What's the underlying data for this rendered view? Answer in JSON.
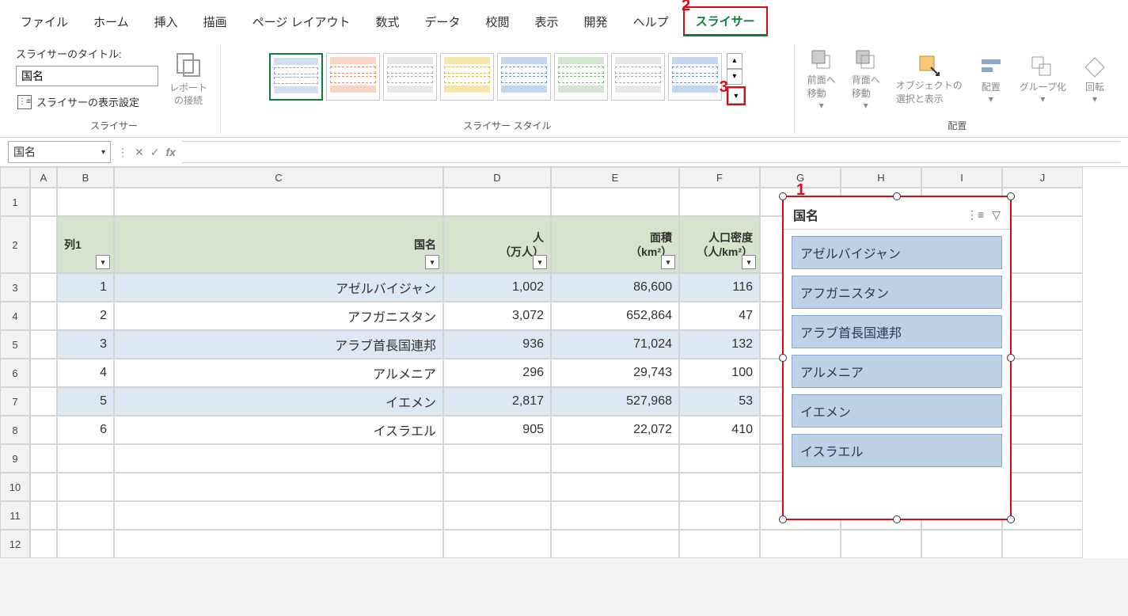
{
  "tabs": [
    "ファイル",
    "ホーム",
    "挿入",
    "描画",
    "ページ レイアウト",
    "数式",
    "データ",
    "校閲",
    "表示",
    "開発",
    "ヘルプ",
    "スライサー"
  ],
  "active_tab_index": 11,
  "ribbon": {
    "slicer_group": {
      "title_label": "スライサーのタイトル:",
      "title_value": "国名",
      "settings_label": "スライサーの表示設定",
      "report_conn_label": "レポート\nの接続",
      "group_name": "スライサー"
    },
    "styles_group_name": "スライサー スタイル",
    "arrange": {
      "bring_forward": "前面へ\n移動",
      "send_backward": "背面へ\n移動",
      "selection_pane": "オブジェクトの\n選択と表示",
      "align": "配置",
      "group": "グループ化",
      "rotate": "回転",
      "group_name": "配置"
    }
  },
  "name_box": "国名",
  "columns": [
    "A",
    "B",
    "C",
    "D",
    "E",
    "F",
    "G",
    "H",
    "I",
    "J"
  ],
  "row_headers": [
    "1",
    "2",
    "3",
    "4",
    "5",
    "6",
    "7",
    "8",
    "9",
    "10",
    "11",
    "12"
  ],
  "table": {
    "headers": {
      "b": "列1",
      "c": "国名",
      "d": "人\n（万人）",
      "e": "面積\n（km²）",
      "f": "人口密度\n（人/km²）"
    },
    "rows": [
      {
        "b": "1",
        "c": "アゼルバイジャン",
        "d": "1,002",
        "e": "86,600",
        "f": "116"
      },
      {
        "b": "2",
        "c": "アフガニスタン",
        "d": "3,072",
        "e": "652,864",
        "f": "47"
      },
      {
        "b": "3",
        "c": "アラブ首長国連邦",
        "d": "936",
        "e": "71,024",
        "f": "132"
      },
      {
        "b": "4",
        "c": "アルメニア",
        "d": "296",
        "e": "29,743",
        "f": "100"
      },
      {
        "b": "5",
        "c": "イエメン",
        "d": "2,817",
        "e": "527,968",
        "f": "53"
      },
      {
        "b": "6",
        "c": "イスラエル",
        "d": "905",
        "e": "22,072",
        "f": "410"
      }
    ]
  },
  "slicer": {
    "title": "国名",
    "items": [
      "アゼルバイジャン",
      "アフガニスタン",
      "アラブ首長国連邦",
      "アルメニア",
      "イエメン",
      "イスラエル"
    ]
  },
  "annotations": {
    "a1": "1",
    "a2": "2",
    "a3": "3"
  }
}
